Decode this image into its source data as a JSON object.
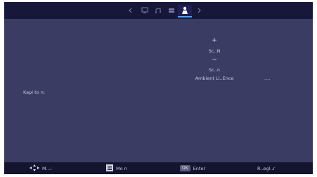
{
  "top_nav": {
    "tabs": [
      {
        "icon": "chevron-left-icon"
      },
      {
        "icon": "display-icon"
      },
      {
        "icon": "audio-icon"
      },
      {
        "icon": "settings-grid-icon"
      },
      {
        "icon": "user-icon",
        "active": true
      },
      {
        "icon": "chevron-right-icon"
      }
    ]
  },
  "panel": {
    "plus_symbol": "+",
    "item_1": "Sc..N",
    "minus_symbol": "−",
    "item_2": "Sc..n",
    "item_3": "Ambient Li..Ence",
    "item_3_value": "....",
    "left_label": "Kapi to  n:"
  },
  "footer": {
    "move_label": "M...:",
    "menu_label": "Mo  n",
    "ok_badge": "OK",
    "enter_label": "Enter",
    "return_label": "R..egl..r"
  },
  "colors": {
    "background": "#3b3c63",
    "bars": "#14142e",
    "accent": "#4aa3ff"
  }
}
